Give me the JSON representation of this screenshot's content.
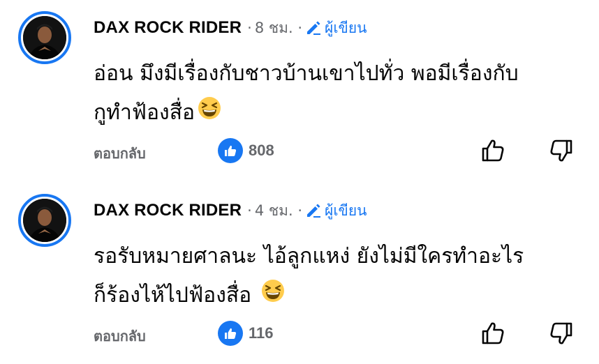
{
  "comments": [
    {
      "author": "DAX ROCK  RIDER",
      "time": "8 ชม.",
      "author_badge": "ผู้เขียน",
      "text_line1": "อ่อน มึงมีเรื่องกับชาวบ้านเขาไปทั่ว พอมีเรื่องกับ",
      "text_line2": "กูทำฟ้องสื่อ",
      "emoji": "grinning-squinting-face",
      "reply_label": "ตอบกลับ",
      "like_count": "808"
    },
    {
      "author": "DAX ROCK  RIDER",
      "time": "4 ชม.",
      "author_badge": "ผู้เขียน",
      "text_line1": "รอรับหมายศาลนะ ไอ้ลูกแหง่ ยังไม่มีใครทำอะไร",
      "text_line2": "ก็ร้องไห้ไปฟ้องสื่อ ",
      "emoji": "grinning-squinting-face",
      "reply_label": "ตอบกลับ",
      "like_count": "116"
    }
  ],
  "colors": {
    "accent": "#1877f2",
    "secondary_text": "#65676b",
    "text": "#050505"
  }
}
